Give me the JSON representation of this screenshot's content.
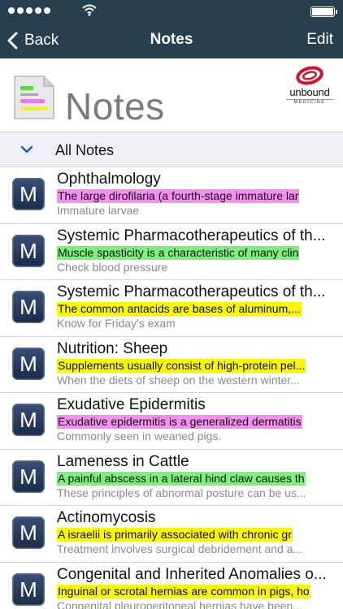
{
  "nav": {
    "back_label": "Back",
    "title": "Notes",
    "edit_label": "Edit"
  },
  "header": {
    "title": "Notes",
    "logo_name": "unbound",
    "logo_sub": "MEDICINE"
  },
  "section": {
    "label": "All Notes"
  },
  "colors": {
    "pink": "#f48ff0",
    "green": "#7cf07a",
    "yellow": "#f9f50a",
    "bar": "#26404f"
  },
  "notes": [
    {
      "title": "Ophthalmology",
      "highlight": "The large dirofilaria (a fourth-stage immature lar",
      "color": "pink",
      "subtitle": "Immature larvae"
    },
    {
      "title": "Systemic Pharmacotherapeutics of th...",
      "highlight": "Muscle spasticity is a characteristic of many clin",
      "color": "green",
      "subtitle": "Check blood pressure"
    },
    {
      "title": "Systemic Pharmacotherapeutics of th...",
      "highlight": "The common antacids are bases of aluminum,...",
      "color": "yellow",
      "subtitle": "Know for Friday's exam"
    },
    {
      "title": "Nutrition: Sheep",
      "highlight": "Supplements usually consist of high-protein pel...",
      "color": "yellow",
      "subtitle": "When the diets of sheep on the western winter..."
    },
    {
      "title": "Exudative Epidermitis",
      "highlight": "Exudative epidermitis is a generalized dermatitis",
      "color": "pink",
      "subtitle": "Commonly seen in weaned pigs."
    },
    {
      "title": "Lameness in Cattle",
      "highlight": "A painful abscess in a lateral hind claw causes th",
      "color": "green",
      "subtitle": "These principles of abnormal posture can be us..."
    },
    {
      "title": "Actinomycosis",
      "highlight": "A israelii is primarily associated with chronic gr",
      "color": "yellow",
      "subtitle": "Treatment involves surgical debridement and a..."
    },
    {
      "title": "Congenital and Inherited Anomalies o...",
      "highlight": "Inguinal or scrotal hernias are common in pigs, ho",
      "color": "yellow",
      "subtitle": "Congenital pleuroperitoneal hernias have been..."
    }
  ],
  "row_icon_letter": "M"
}
